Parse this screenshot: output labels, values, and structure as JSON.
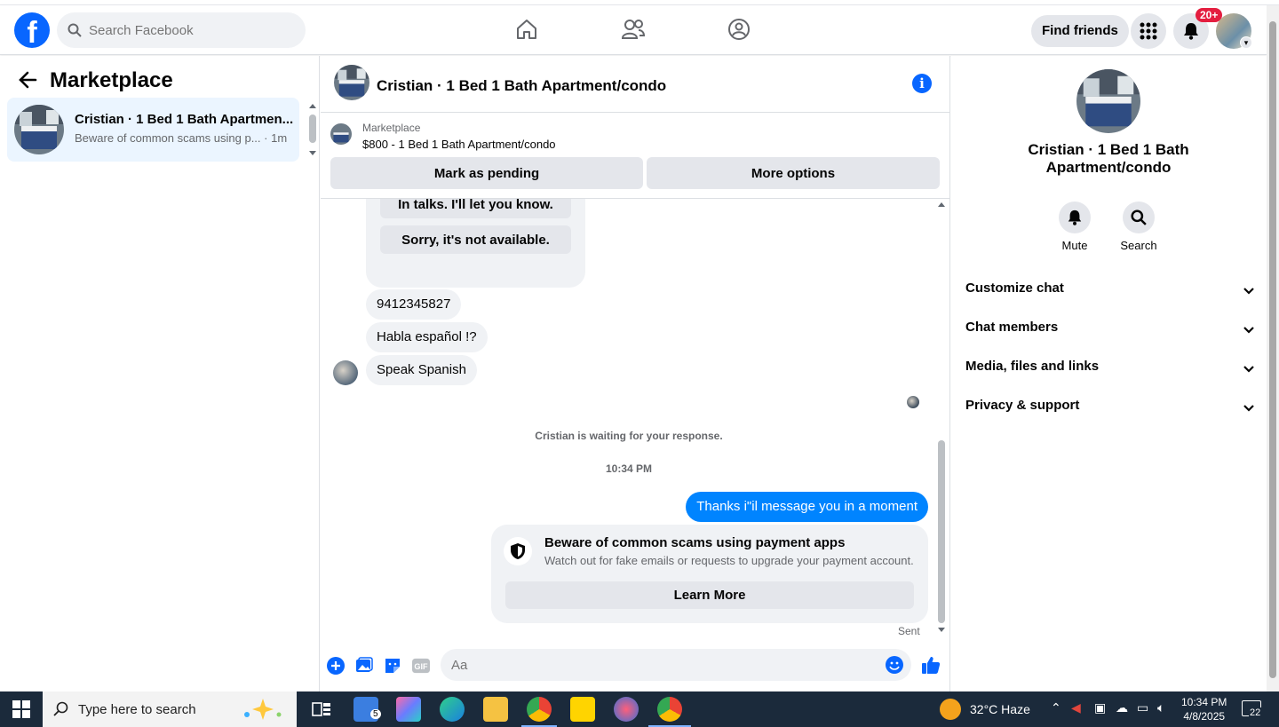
{
  "header": {
    "logo": "f",
    "search_placeholder": "Search Facebook",
    "find_friends": "Find friends",
    "notifications_badge": "20+"
  },
  "left": {
    "title": "Marketplace",
    "conversation": {
      "title": "Cristian · 1 Bed 1 Bath Apartmen...",
      "preview": "Beware of common scams using p... · 1m"
    }
  },
  "chat": {
    "title": "Cristian · 1 Bed 1 Bath Apartment/condo",
    "listing": {
      "source": "Marketplace",
      "price_title": "$800 - 1 Bed 1 Bath Apartment/condo",
      "btn_pending": "Mark as pending",
      "btn_more": "More options"
    },
    "quick_replies": [
      "In talks. I'll let you know.",
      "Sorry, it's not available."
    ],
    "messages": [
      "9412345827",
      "Habla español !?",
      "Speak Spanish"
    ],
    "waiting": "Cristian is waiting for your response.",
    "time": "10:34 PM",
    "my_message": "Thanks i\"il message you in a moment",
    "scam": {
      "title": "Beware of common scams using payment apps",
      "body": "Watch out for fake emails or requests to upgrade your payment account.",
      "button": "Learn More"
    },
    "sent": "Sent",
    "composer_placeholder": "Aa"
  },
  "right": {
    "name": "Cristian · 1 Bed 1 Bath Apartment/condo",
    "mute": "Mute",
    "search": "Search",
    "rows": [
      "Customize chat",
      "Chat members",
      "Media, files and links",
      "Privacy & support"
    ]
  },
  "taskbar": {
    "search_placeholder": "Type here to search",
    "task_badge": "5",
    "weather": "32°C  Haze",
    "time": "10:34 PM",
    "date": "4/8/2025",
    "notif_count": "22"
  },
  "colors": {
    "brand": "#0866ff",
    "my_bubble": "#0084ff",
    "selected_convo": "#ebf5ff",
    "badge": "#e41e3f"
  }
}
